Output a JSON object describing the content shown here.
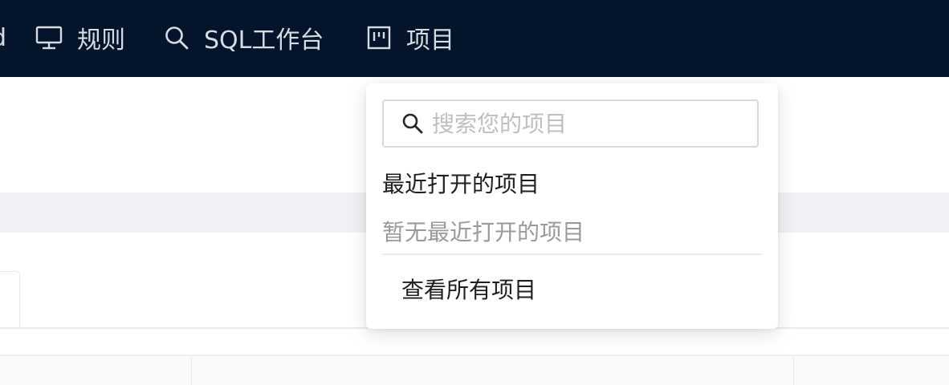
{
  "topbar": {
    "clipped_label": "d",
    "items": [
      {
        "label": "规则",
        "icon": "monitor-icon"
      },
      {
        "label": "SQL工作台",
        "icon": "search-icon"
      },
      {
        "label": "项目",
        "icon": "project-board-icon"
      }
    ]
  },
  "project_dropdown": {
    "search_placeholder": "搜索您的项目",
    "recent_title": "最近打开的项目",
    "recent_empty": "暂无最近打开的项目",
    "view_all_label": "查看所有项目"
  },
  "colors": {
    "topbar_bg": "#03142b",
    "band_bg": "#f0f1f5"
  }
}
